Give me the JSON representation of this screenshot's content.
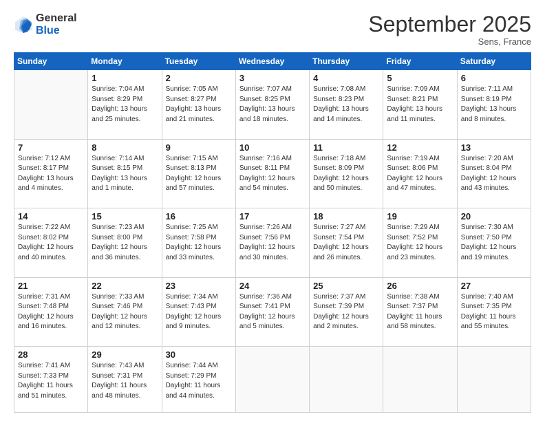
{
  "header": {
    "logo_general": "General",
    "logo_blue": "Blue",
    "month_year": "September 2025",
    "location": "Sens, France"
  },
  "days_of_week": [
    "Sunday",
    "Monday",
    "Tuesday",
    "Wednesday",
    "Thursday",
    "Friday",
    "Saturday"
  ],
  "weeks": [
    [
      {
        "day": "",
        "info": ""
      },
      {
        "day": "1",
        "info": "Sunrise: 7:04 AM\nSunset: 8:29 PM\nDaylight: 13 hours\nand 25 minutes."
      },
      {
        "day": "2",
        "info": "Sunrise: 7:05 AM\nSunset: 8:27 PM\nDaylight: 13 hours\nand 21 minutes."
      },
      {
        "day": "3",
        "info": "Sunrise: 7:07 AM\nSunset: 8:25 PM\nDaylight: 13 hours\nand 18 minutes."
      },
      {
        "day": "4",
        "info": "Sunrise: 7:08 AM\nSunset: 8:23 PM\nDaylight: 13 hours\nand 14 minutes."
      },
      {
        "day": "5",
        "info": "Sunrise: 7:09 AM\nSunset: 8:21 PM\nDaylight: 13 hours\nand 11 minutes."
      },
      {
        "day": "6",
        "info": "Sunrise: 7:11 AM\nSunset: 8:19 PM\nDaylight: 13 hours\nand 8 minutes."
      }
    ],
    [
      {
        "day": "7",
        "info": "Sunrise: 7:12 AM\nSunset: 8:17 PM\nDaylight: 13 hours\nand 4 minutes."
      },
      {
        "day": "8",
        "info": "Sunrise: 7:14 AM\nSunset: 8:15 PM\nDaylight: 13 hours\nand 1 minute."
      },
      {
        "day": "9",
        "info": "Sunrise: 7:15 AM\nSunset: 8:13 PM\nDaylight: 12 hours\nand 57 minutes."
      },
      {
        "day": "10",
        "info": "Sunrise: 7:16 AM\nSunset: 8:11 PM\nDaylight: 12 hours\nand 54 minutes."
      },
      {
        "day": "11",
        "info": "Sunrise: 7:18 AM\nSunset: 8:09 PM\nDaylight: 12 hours\nand 50 minutes."
      },
      {
        "day": "12",
        "info": "Sunrise: 7:19 AM\nSunset: 8:06 PM\nDaylight: 12 hours\nand 47 minutes."
      },
      {
        "day": "13",
        "info": "Sunrise: 7:20 AM\nSunset: 8:04 PM\nDaylight: 12 hours\nand 43 minutes."
      }
    ],
    [
      {
        "day": "14",
        "info": "Sunrise: 7:22 AM\nSunset: 8:02 PM\nDaylight: 12 hours\nand 40 minutes."
      },
      {
        "day": "15",
        "info": "Sunrise: 7:23 AM\nSunset: 8:00 PM\nDaylight: 12 hours\nand 36 minutes."
      },
      {
        "day": "16",
        "info": "Sunrise: 7:25 AM\nSunset: 7:58 PM\nDaylight: 12 hours\nand 33 minutes."
      },
      {
        "day": "17",
        "info": "Sunrise: 7:26 AM\nSunset: 7:56 PM\nDaylight: 12 hours\nand 30 minutes."
      },
      {
        "day": "18",
        "info": "Sunrise: 7:27 AM\nSunset: 7:54 PM\nDaylight: 12 hours\nand 26 minutes."
      },
      {
        "day": "19",
        "info": "Sunrise: 7:29 AM\nSunset: 7:52 PM\nDaylight: 12 hours\nand 23 minutes."
      },
      {
        "day": "20",
        "info": "Sunrise: 7:30 AM\nSunset: 7:50 PM\nDaylight: 12 hours\nand 19 minutes."
      }
    ],
    [
      {
        "day": "21",
        "info": "Sunrise: 7:31 AM\nSunset: 7:48 PM\nDaylight: 12 hours\nand 16 minutes."
      },
      {
        "day": "22",
        "info": "Sunrise: 7:33 AM\nSunset: 7:46 PM\nDaylight: 12 hours\nand 12 minutes."
      },
      {
        "day": "23",
        "info": "Sunrise: 7:34 AM\nSunset: 7:43 PM\nDaylight: 12 hours\nand 9 minutes."
      },
      {
        "day": "24",
        "info": "Sunrise: 7:36 AM\nSunset: 7:41 PM\nDaylight: 12 hours\nand 5 minutes."
      },
      {
        "day": "25",
        "info": "Sunrise: 7:37 AM\nSunset: 7:39 PM\nDaylight: 12 hours\nand 2 minutes."
      },
      {
        "day": "26",
        "info": "Sunrise: 7:38 AM\nSunset: 7:37 PM\nDaylight: 11 hours\nand 58 minutes."
      },
      {
        "day": "27",
        "info": "Sunrise: 7:40 AM\nSunset: 7:35 PM\nDaylight: 11 hours\nand 55 minutes."
      }
    ],
    [
      {
        "day": "28",
        "info": "Sunrise: 7:41 AM\nSunset: 7:33 PM\nDaylight: 11 hours\nand 51 minutes."
      },
      {
        "day": "29",
        "info": "Sunrise: 7:43 AM\nSunset: 7:31 PM\nDaylight: 11 hours\nand 48 minutes."
      },
      {
        "day": "30",
        "info": "Sunrise: 7:44 AM\nSunset: 7:29 PM\nDaylight: 11 hours\nand 44 minutes."
      },
      {
        "day": "",
        "info": ""
      },
      {
        "day": "",
        "info": ""
      },
      {
        "day": "",
        "info": ""
      },
      {
        "day": "",
        "info": ""
      }
    ]
  ]
}
